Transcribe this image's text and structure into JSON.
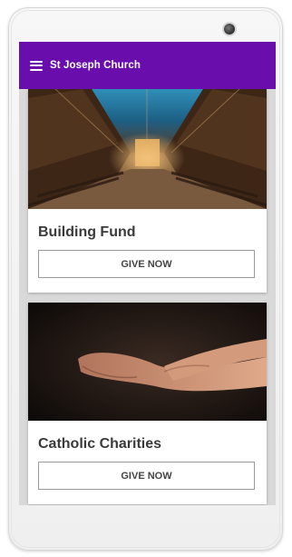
{
  "app": {
    "title": "St Joseph Church"
  },
  "cards": [
    {
      "title": "Building Fund",
      "button_label": "GIVE NOW",
      "image": "church-interior"
    },
    {
      "title": "Catholic Charities",
      "button_label": "GIVE NOW",
      "image": "helping-hands"
    }
  ],
  "colors": {
    "appbar": "#6a0dad",
    "card_bg": "#ffffff",
    "background": "#d9d9d9"
  },
  "icons": {
    "menu": "hamburger-menu-icon"
  }
}
